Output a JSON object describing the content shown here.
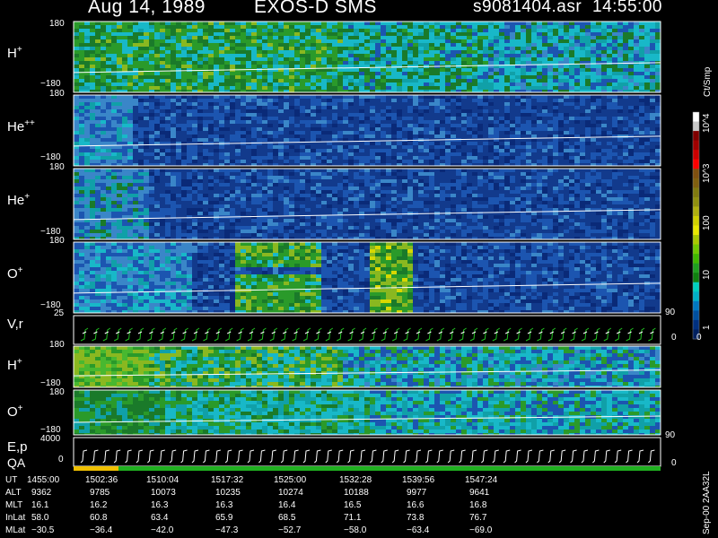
{
  "header": {
    "date": "Aug 14, 1989",
    "instrument": "EXOS-D SMS",
    "file": "s9081404.asr",
    "time": "14:55:00"
  },
  "units_label": "Ct/Smp",
  "footer_stamp": "Sep-00  2AA32L",
  "colorbar": {
    "ticks": [
      "10^4",
      "10^3",
      "100",
      "10",
      "1",
      "0"
    ],
    "colors": [
      "#ffffff",
      "#c8c8c8",
      "#800000",
      "#a00000",
      "#cc0000",
      "#ff0000",
      "#805010",
      "#806010",
      "#807a10",
      "#909010",
      "#b0b010",
      "#d0d000",
      "#e8e800",
      "#a8c800",
      "#70c800",
      "#40b800",
      "#20a020",
      "#108010",
      "#00d0c0",
      "#00b0c8",
      "#0078c0",
      "#0050a0",
      "#003080",
      "#002060"
    ]
  },
  "chart_data": [
    {
      "type": "heatmap",
      "panel": "H+",
      "label_base": "H",
      "label_sup": "+",
      "ymax": "180",
      "ymin": "−180"
    },
    {
      "type": "heatmap",
      "panel": "He++",
      "label_base": "He",
      "label_sup": "++",
      "ymax": "180",
      "ymin": "−180"
    },
    {
      "type": "heatmap",
      "panel": "He+",
      "label_base": "He",
      "label_sup": "+",
      "ymax": "180",
      "ymin": "−180"
    },
    {
      "type": "heatmap",
      "panel": "O+",
      "label_base": "O",
      "label_sup": "+",
      "ymax": "180",
      "ymin": "−180"
    },
    {
      "type": "line",
      "panel": "V,r",
      "label": "V,r",
      "y_left": "25",
      "y_right_top": "90",
      "y_right_bottom": "0"
    },
    {
      "type": "heatmap",
      "panel": "H+ (2)",
      "label_base": "H",
      "label_sup": "+",
      "ymax": "180",
      "ymin": "−180"
    },
    {
      "type": "heatmap",
      "panel": "O+ (2)",
      "label_base": "O",
      "label_sup": "+",
      "ymax": "180",
      "ymin": "−180"
    },
    {
      "type": "line",
      "panel": "E,p / QA",
      "label_top": "E,p",
      "label_bottom": "QA",
      "y_left_top": "4000",
      "y_left_bottom": "0",
      "y_right_top": "90",
      "y_right_bottom": "0"
    }
  ],
  "ephemeris": {
    "rows": [
      {
        "name": "UT",
        "values": [
          "1455:00",
          "1502:36",
          "1510:04",
          "1517:32",
          "1525:00",
          "1532:28",
          "1539:56",
          "1547:24"
        ]
      },
      {
        "name": "ALT",
        "values": [
          "9362",
          "9785",
          "10073",
          "10235",
          "10274",
          "10188",
          "9977",
          "9641"
        ]
      },
      {
        "name": "MLT",
        "values": [
          "16.1",
          "16.2",
          "16.3",
          "16.3",
          "16.4",
          "16.5",
          "16.6",
          "16.8"
        ]
      },
      {
        "name": "InLat",
        "values": [
          "58.0",
          "60.8",
          "63.4",
          "65.9",
          "68.5",
          "71.1",
          "73.8",
          "76.7"
        ]
      },
      {
        "name": "MLat",
        "values": [
          "−30.5",
          "−36.4",
          "−42.0",
          "−47.3",
          "−52.7",
          "−58.0",
          "−63.4",
          "−69.0"
        ]
      }
    ]
  }
}
